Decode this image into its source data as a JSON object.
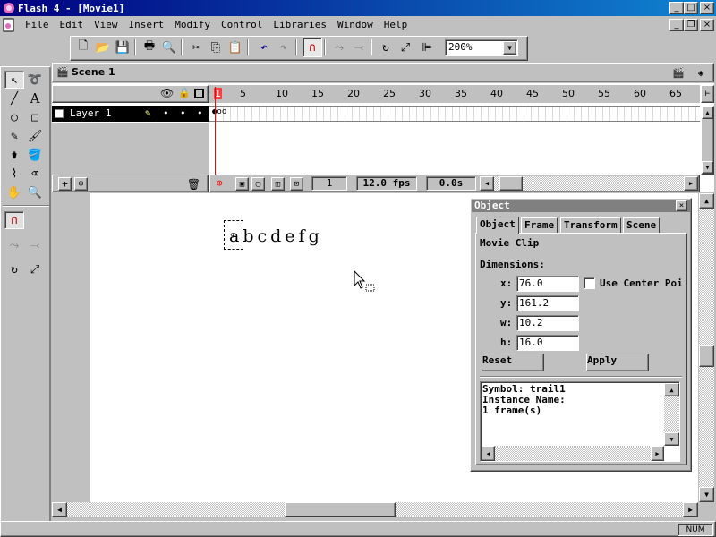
{
  "window": {
    "title": "Flash 4 - [Movie1]",
    "minimize_glyph": "_",
    "maximize_glyph": "□",
    "close_glyph": "×",
    "restore_glyph": "❐"
  },
  "menu": [
    {
      "label": "File"
    },
    {
      "label": "Edit"
    },
    {
      "label": "View"
    },
    {
      "label": "Insert"
    },
    {
      "label": "Modify"
    },
    {
      "label": "Control"
    },
    {
      "label": "Libraries"
    },
    {
      "label": "Window"
    },
    {
      "label": "Help"
    }
  ],
  "toolbar": {
    "zoom": "200%"
  },
  "scene": {
    "name": "Scene 1"
  },
  "timeline": {
    "layer_name": "Layer 1",
    "ruler": [
      "1",
      "5",
      "10",
      "15",
      "20",
      "25",
      "30",
      "35",
      "40",
      "45",
      "50",
      "55",
      "60",
      "65"
    ],
    "current_frame": "1",
    "fps": "12.0 fps",
    "time": "0.0s"
  },
  "stage": {
    "text": "abcdefg"
  },
  "object_panel": {
    "title": "Object",
    "tabs": [
      "Object",
      "Frame",
      "Transform",
      "Scene"
    ],
    "type": "Movie Clip",
    "dimensions_label": "Dimensions:",
    "x_label": "x:",
    "x_value": "76.0",
    "y_label": "y:",
    "y_value": "161.2",
    "w_label": "w:",
    "w_value": "10.2",
    "h_label": "h:",
    "h_value": "16.0",
    "use_center": "Use Center Poi",
    "reset": "Reset",
    "apply": "Apply",
    "info_symbol": "Symbol: trail1",
    "info_instance": "Instance Name:",
    "info_frames": "1 frame(s)"
  },
  "statusbar": {
    "num": "NUM"
  },
  "colors": {
    "titlebar": "#000080",
    "playhead": "#ff0000"
  }
}
